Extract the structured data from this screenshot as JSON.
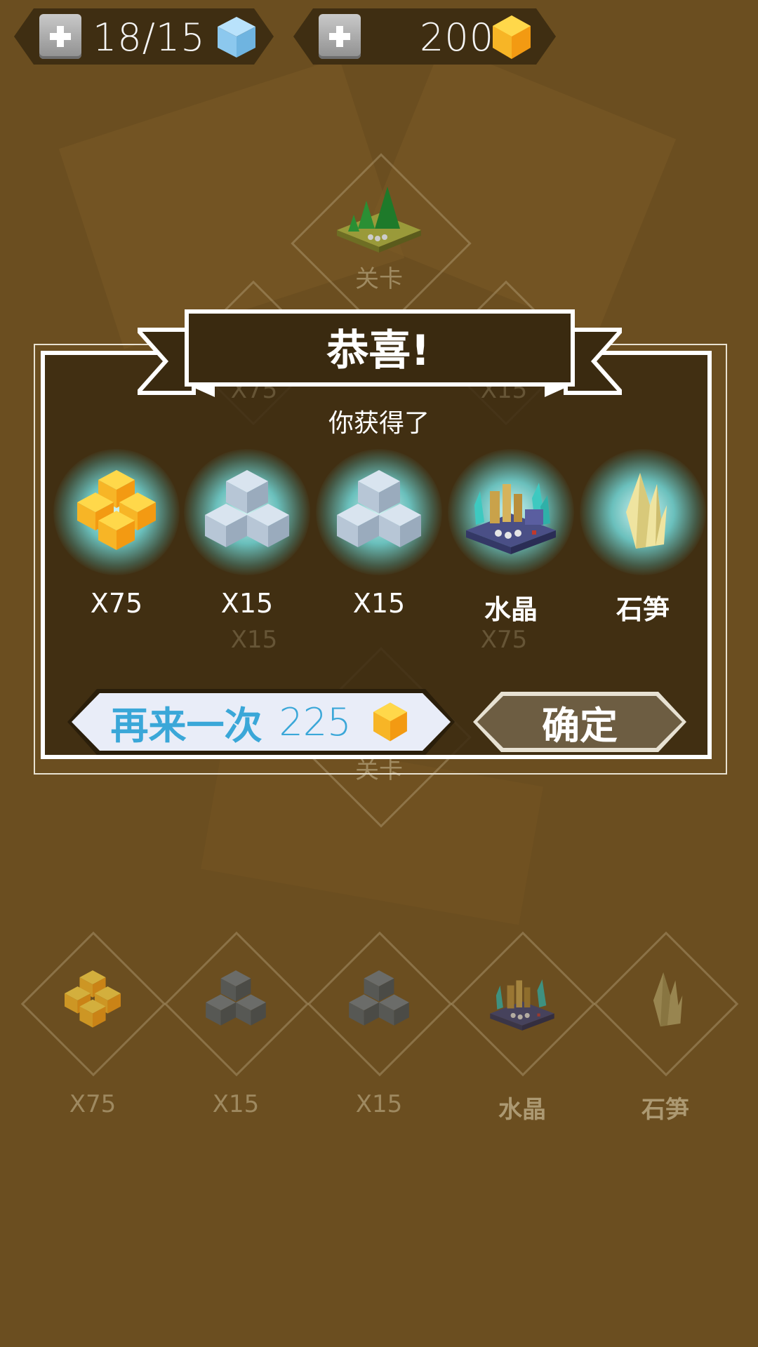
{
  "header": {
    "energy": {
      "value": "18/15",
      "icon": "blue-cube-icon"
    },
    "coins": {
      "value": "200",
      "icon": "gold-gem-icon"
    }
  },
  "background": {
    "level_label": "关卡",
    "level_label_2": "关卡",
    "faded_labels": [
      "X75",
      "X15",
      "X15",
      "X75"
    ],
    "bottom_items": [
      {
        "label": "X75",
        "icon": "gold-cubes-icon"
      },
      {
        "label": "X15",
        "icon": "dark-cubes-icon"
      },
      {
        "label": "X15",
        "icon": "dark-cubes-icon"
      },
      {
        "label": "水晶",
        "icon": "crystal-scene-icon"
      },
      {
        "label": "石笋",
        "icon": "stalagmite-icon"
      }
    ]
  },
  "dialog": {
    "title": "恭喜!",
    "subtitle": "你获得了",
    "rewards": [
      {
        "label": "X75",
        "icon": "gold-cubes-icon"
      },
      {
        "label": "X15",
        "icon": "ice-cubes-icon"
      },
      {
        "label": "X15",
        "icon": "ice-cubes-icon"
      },
      {
        "label": "水晶",
        "icon": "crystal-scene-icon"
      },
      {
        "label": "石笋",
        "icon": "stalagmite-icon"
      }
    ],
    "retry_button": {
      "label": "再来一次",
      "cost": "225",
      "icon": "gold-gem-icon"
    },
    "confirm_button": {
      "label": "确定"
    }
  },
  "colors": {
    "background": "#6b4e20",
    "dialog_bg": "#3a2a10",
    "retry_text": "#3aa7d8",
    "confirm_bg": "#6d5d42",
    "gold": "#f6b21a"
  }
}
